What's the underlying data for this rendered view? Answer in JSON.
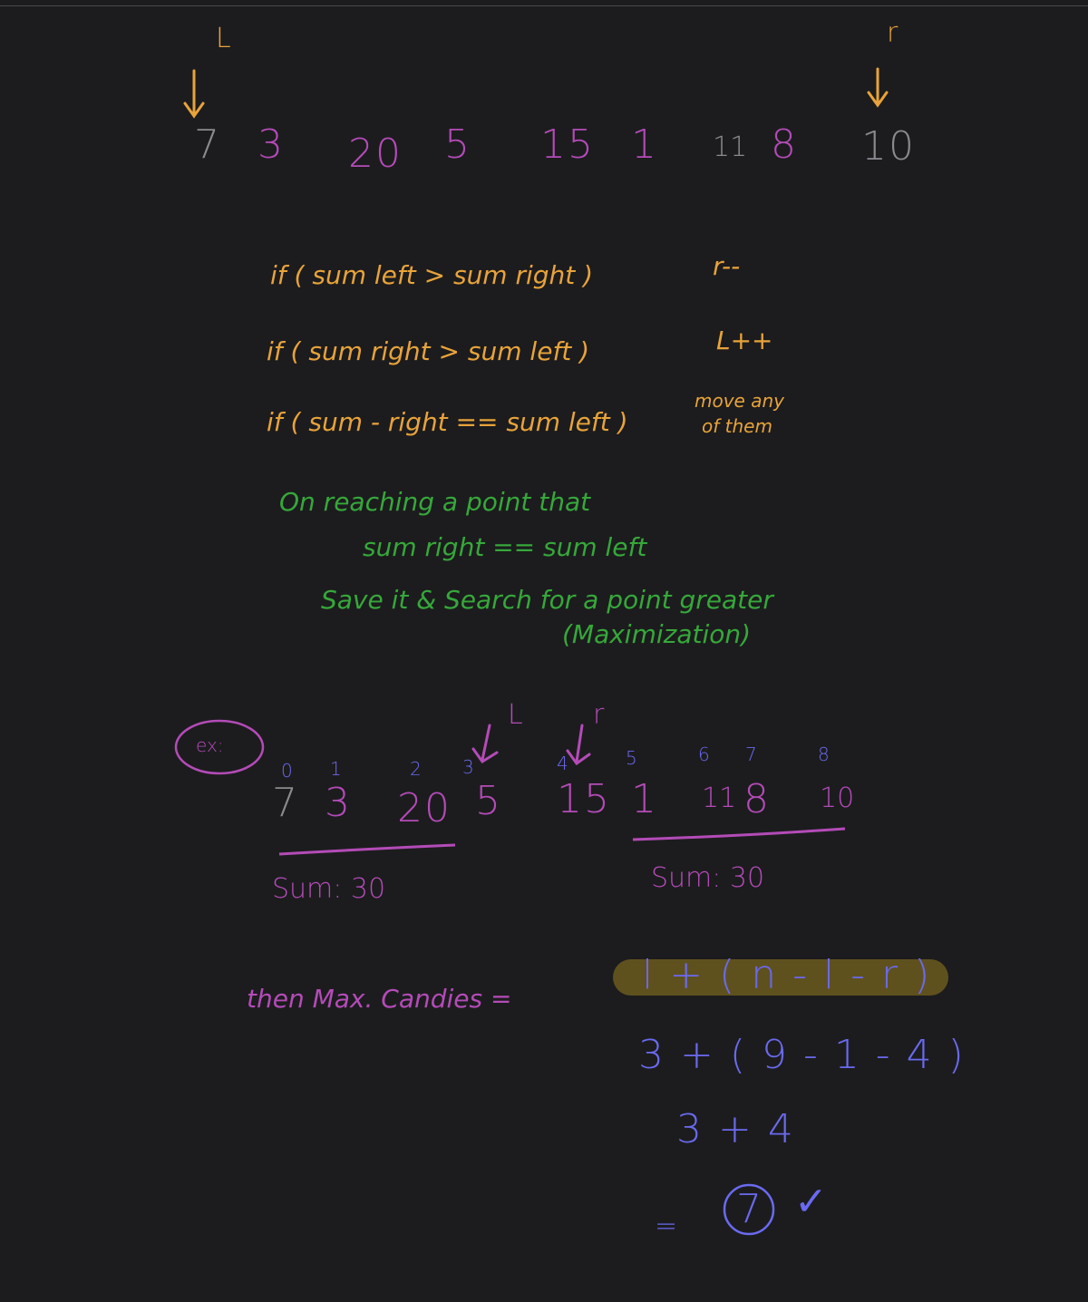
{
  "colors": {
    "background": "#1c1c1e",
    "orange": "#e8a33a",
    "green": "#36a83a",
    "purple": "#b44bb8",
    "blue": "#6a6af0",
    "gray": "#8a8a8f",
    "highlight": "#6b5a1e"
  },
  "top": {
    "pointer_left": "L",
    "pointer_right": "r",
    "numbers": [
      "7",
      "3",
      "20",
      "5",
      "15",
      "1",
      "11",
      "8",
      "10"
    ]
  },
  "conditions": [
    {
      "text": "if ( sum left > sum right )",
      "action": "r--"
    },
    {
      "text": "if ( sum right > sum left )",
      "action": "L++"
    },
    {
      "text": "if ( sum - right == sum left )",
      "action_line1": "move any",
      "action_line2": "of them"
    }
  ],
  "note": {
    "line1": "On reaching a point that",
    "line2": "sum right == sum left",
    "line3": "Save it & Search for a point greater",
    "line4": "(Maximization)"
  },
  "example": {
    "tag": "ex:",
    "pointer_left": "L",
    "pointer_right": "r",
    "indices": [
      "0",
      "1",
      "2",
      "3",
      "4",
      "5",
      "6",
      "7",
      "8"
    ],
    "numbers": [
      "7",
      "3",
      "20",
      "5",
      "15",
      "1",
      "11",
      "8",
      "10"
    ],
    "sum_left": "Sum: 30",
    "sum_right": "Sum: 30"
  },
  "formula": {
    "label": "then Max. Candies =",
    "line1": "l + ( n - l - r )",
    "line2": "3 + ( 9 - 1 - 4 )",
    "line3": "3 + 4",
    "equals": "=",
    "result": "7",
    "check": "✓"
  },
  "icons": [
    "down-arrow-icon",
    "check-mark-icon"
  ]
}
